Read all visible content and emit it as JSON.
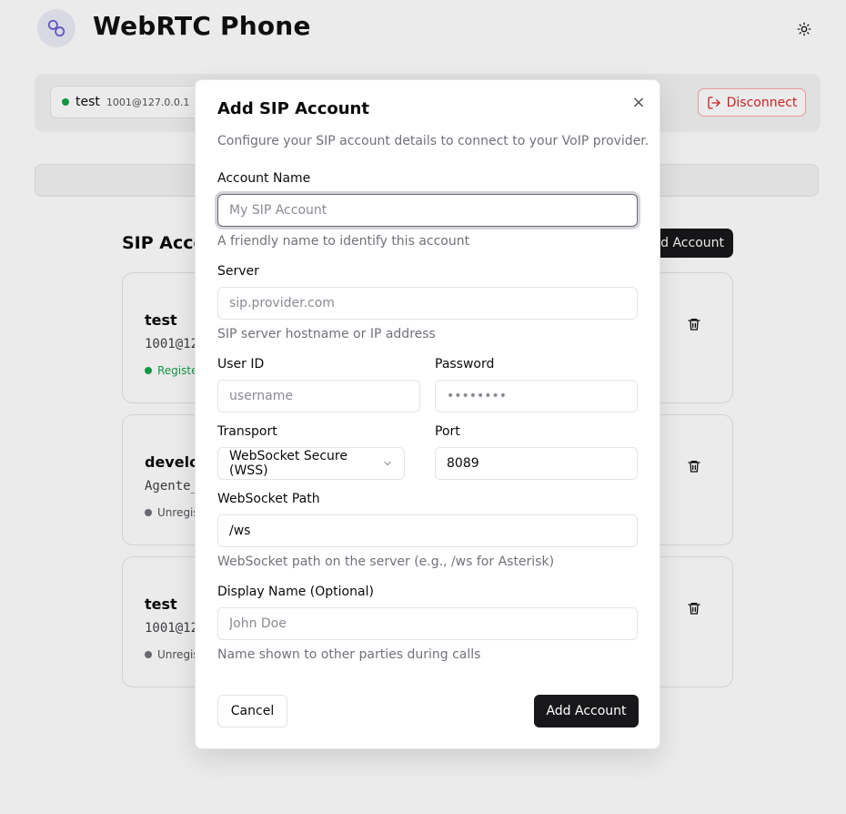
{
  "app": {
    "title": "WebRTC Phone",
    "icons": {
      "logo": "link-icon",
      "theme": "sun-icon",
      "disconnect": "log-out-icon"
    }
  },
  "connection": {
    "account_name": "test",
    "account_uri": "1001@127.0.0.1",
    "status_color": "#16a34a",
    "disconnect_label": "Disconnect"
  },
  "accounts_section": {
    "title": "SIP Accou",
    "add_label": "dd Account"
  },
  "accounts": [
    {
      "name": "test",
      "uri": "1001@12",
      "status": "Registe",
      "status_color": "#16a34a"
    },
    {
      "name": "develop",
      "uri": "Agente_",
      "status": "Unregis",
      "status_color": "#71717a"
    },
    {
      "name": "test",
      "uri": "1001@12",
      "status": "Unregis",
      "status_color": "#71717a"
    }
  ],
  "dialog": {
    "title": "Add SIP Account",
    "description": "Configure your SIP account details to connect to your VoIP provider.",
    "fields": {
      "account_name": {
        "label": "Account Name",
        "placeholder": "My SIP Account",
        "value": "",
        "hint": "A friendly name to identify this account"
      },
      "server": {
        "label": "Server",
        "placeholder": "sip.provider.com",
        "value": "",
        "hint": "SIP server hostname or IP address"
      },
      "user_id": {
        "label": "User ID",
        "placeholder": "username",
        "value": ""
      },
      "password": {
        "label": "Password",
        "placeholder": "••••••••",
        "value": ""
      },
      "transport": {
        "label": "Transport",
        "value": "WebSocket Secure (WSS)"
      },
      "port": {
        "label": "Port",
        "value": "8089"
      },
      "ws_path": {
        "label": "WebSocket Path",
        "value": "/ws",
        "hint": "WebSocket path on the server (e.g., /ws for Asterisk)"
      },
      "display_name": {
        "label": "Display Name (Optional)",
        "placeholder": "John Doe",
        "value": "",
        "hint": "Name shown to other parties during calls"
      }
    },
    "cancel_label": "Cancel",
    "submit_label": "Add Account",
    "close_glyph": "×"
  },
  "colors": {
    "primary": "#18181b",
    "danger": "#dc2626",
    "success": "#16a34a",
    "muted": "#71717a"
  }
}
